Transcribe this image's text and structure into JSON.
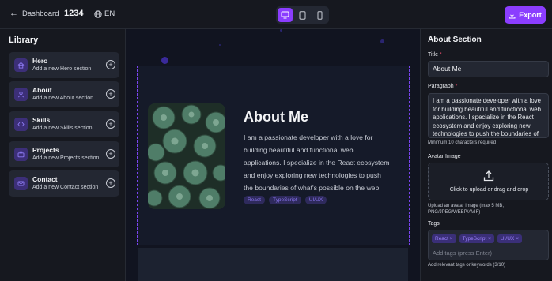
{
  "topbar": {
    "back_label": "Dashboard",
    "project_id": "1234",
    "language": "EN",
    "export_label": "Export"
  },
  "devices": [
    "desktop-icon",
    "tablet-icon",
    "mobile-icon"
  ],
  "active_device": "desktop",
  "library": {
    "title": "Library",
    "items": [
      {
        "name": "Hero",
        "desc": "Add a new Hero section",
        "icon": "home-icon"
      },
      {
        "name": "About",
        "desc": "Add a new About section",
        "icon": "user-icon"
      },
      {
        "name": "Skills",
        "desc": "Add a new Skills section",
        "icon": "code-icon"
      },
      {
        "name": "Projects",
        "desc": "Add a new Projects section",
        "icon": "briefcase-icon"
      },
      {
        "name": "Contact",
        "desc": "Add a new Contact section",
        "icon": "mail-icon"
      }
    ]
  },
  "preview": {
    "title": "About Me",
    "paragraph": "I am a passionate developer with a love for building beautiful and functional web applications. I specialize in the React ecosystem and enjoy exploring new technologies to push the boundaries of what's possible on the web.",
    "chips": [
      "React",
      "TypeScript",
      "UI/UX"
    ]
  },
  "panel": {
    "title": "About Section",
    "title_label": "Title",
    "title_value": "About Me",
    "paragraph_label": "Paragraph",
    "paragraph_value": "I am a passionate developer with a love for building beautiful and functional web applications. I specialize in the React ecosystem and enjoy exploring new technologies to push the boundaries of what's possible on the web.",
    "paragraph_hint": "Minimum 10 characters required",
    "avatar_label": "Avatar Image",
    "upload_text": "Click to upload or drag and drop",
    "upload_hint": "Upload an avatar image (max 5 MB, PNG/JPEG/WEBP/AVIF)",
    "tags_label": "Tags",
    "tags": [
      "React",
      "TypeScript",
      "UI/UX"
    ],
    "tags_placeholder": "Add tags (press Enter)",
    "tags_hint": "Add relevant tags or keywords (3/10)"
  },
  "colors": {
    "accent": "#8b3dff",
    "background": "#0f1117",
    "panel": "#16181f",
    "required": "#f0506e"
  }
}
